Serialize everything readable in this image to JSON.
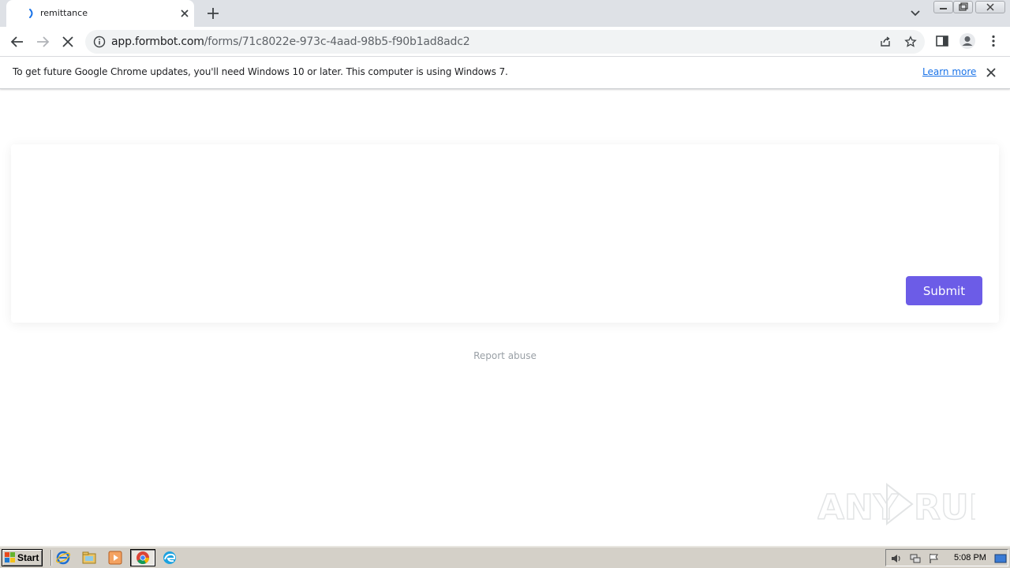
{
  "browser": {
    "tab": {
      "title": "remittance"
    },
    "address": {
      "host": "app.formbot.com",
      "path": "/forms/71c8022e-973c-4aad-98b5-f90b1ad8adc2"
    },
    "infobar": {
      "message": "To get future Google Chrome updates, you'll need Windows 10 or later. This computer is using Windows 7.",
      "link": "Learn more"
    }
  },
  "page": {
    "submit_label": "Submit",
    "report_label": "Report abuse",
    "accent_color": "#6c5ce7"
  },
  "watermark": {
    "text": "ANY RUN"
  },
  "taskbar": {
    "start_label": "Start",
    "clock": "5:08 PM",
    "icons": [
      "ie-icon",
      "explorer-icon",
      "media-player-icon",
      "chrome-icon",
      "edge-icon"
    ]
  }
}
